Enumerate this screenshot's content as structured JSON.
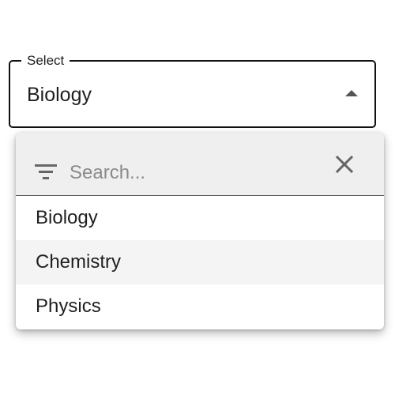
{
  "select": {
    "label": "Select",
    "value": "Biology",
    "arrow_icon": "arrow-up-icon"
  },
  "search": {
    "placeholder": "Search...",
    "value": "",
    "filter_icon": "filter-icon",
    "clear_icon": "close-icon"
  },
  "options": [
    {
      "label": "Biology"
    },
    {
      "label": "Chemistry"
    },
    {
      "label": "Physics"
    }
  ],
  "colors": {
    "border": "#111111",
    "search_bg": "#efefef",
    "hover_bg": "#f4f4f4",
    "icon": "#666666"
  }
}
